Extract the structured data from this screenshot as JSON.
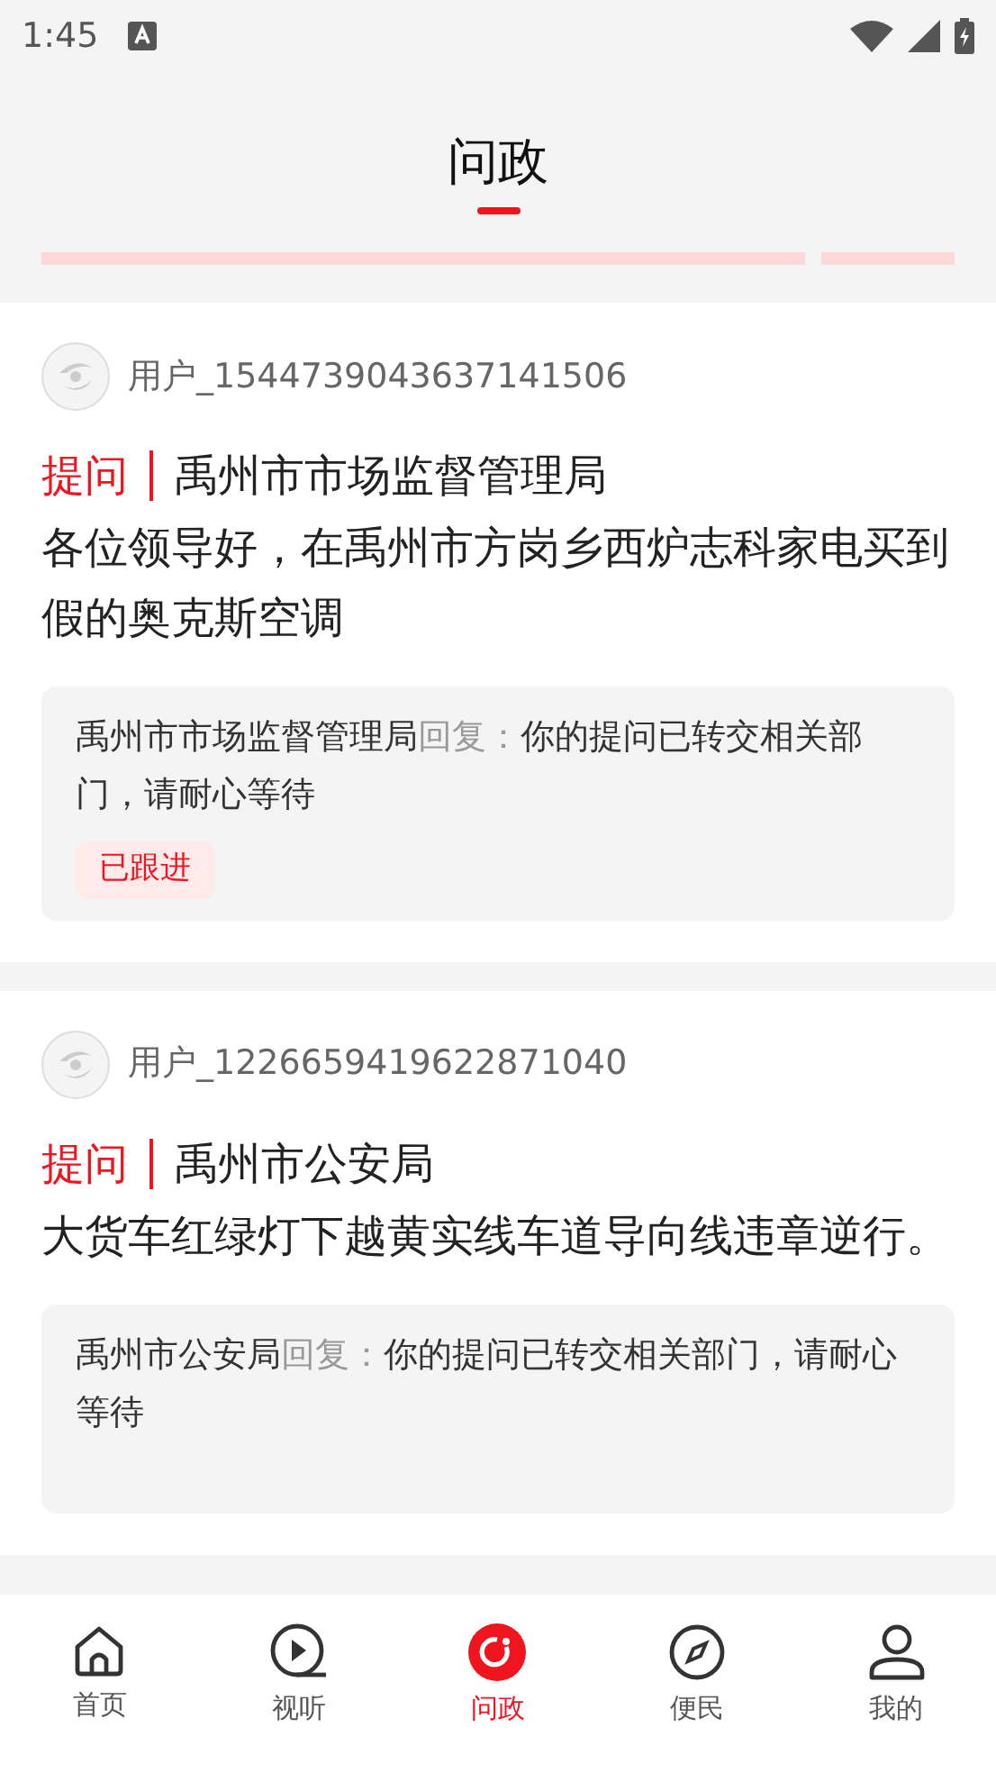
{
  "status_bar": {
    "time": "1:45"
  },
  "header": {
    "title": "问政",
    "selected": true
  },
  "posts": [
    {
      "user": "用户_1544739043637141506",
      "tag": "提问",
      "department": "禹州市市场监督管理局",
      "question": "各位领导好，在禹州市方岗乡西炉志科家电买到假的奥克斯空调",
      "reply": {
        "from": "禹州市市场监督管理局",
        "label": "回复：",
        "text": "你的提问已转交相关部门，请耐心等待"
      },
      "status": "已跟进"
    },
    {
      "user": "用户_1226659419622871040",
      "tag": "提问",
      "department": "禹州市公安局",
      "question": "大货车红绿灯下越黄实线车道导向线违章逆行。",
      "reply": {
        "from": "禹州市公安局",
        "label": "回复：",
        "text": "你的提问已转交相关部门，请耐心等待"
      }
    }
  ],
  "nav": [
    {
      "label": "首页",
      "selected": false
    },
    {
      "label": "视听",
      "selected": false
    },
    {
      "label": "问政",
      "selected": true
    },
    {
      "label": "便民",
      "selected": false
    },
    {
      "label": "我的",
      "selected": false
    }
  ]
}
